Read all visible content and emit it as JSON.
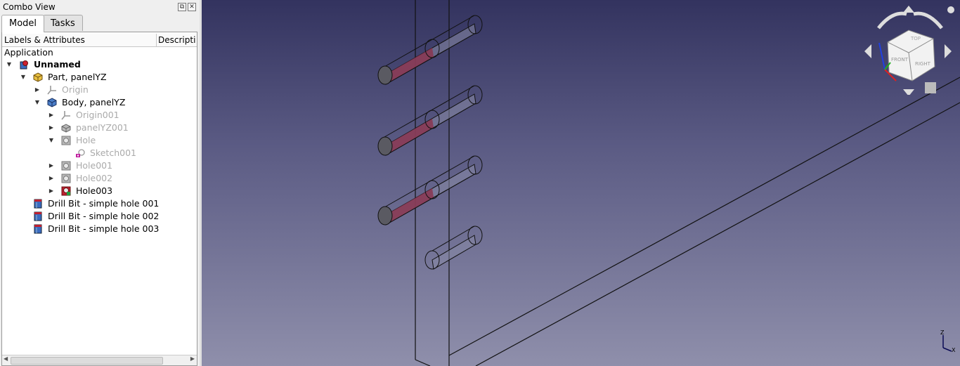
{
  "panel": {
    "title": "Combo View",
    "tabs": [
      {
        "label": "Model"
      },
      {
        "label": "Tasks"
      }
    ],
    "columns": [
      "Labels & Attributes",
      "Descripti"
    ]
  },
  "tree": {
    "root_label": "Application",
    "items": [
      {
        "label": "Unnamed",
        "icon": "document-icon"
      },
      {
        "label": "Part, panelYZ",
        "icon": "part-icon"
      },
      {
        "label": "Origin",
        "icon": "origin-icon"
      },
      {
        "label": "Body, panelYZ",
        "icon": "body-icon"
      },
      {
        "label": "Origin001",
        "icon": "origin-icon"
      },
      {
        "label": "panelYZ001",
        "icon": "pad-icon"
      },
      {
        "label": "Hole",
        "icon": "hole-icon"
      },
      {
        "label": "Sketch001",
        "icon": "sketch-icon"
      },
      {
        "label": "Hole001",
        "icon": "hole-icon"
      },
      {
        "label": "Hole002",
        "icon": "hole-icon"
      },
      {
        "label": "Hole003",
        "icon": "hole-tip-icon"
      },
      {
        "label": "Drill Bit - simple hole 001",
        "icon": "drill-bit-icon"
      },
      {
        "label": "Drill Bit - simple hole 002",
        "icon": "drill-bit-icon"
      },
      {
        "label": "Drill Bit - simple hole 003",
        "icon": "drill-bit-icon"
      }
    ]
  },
  "nav_cube": {
    "faces": [
      "TOP",
      "FRONT",
      "RIGHT"
    ],
    "axis_labels": [
      "Z",
      "X"
    ]
  },
  "colors": {
    "view_top": "#33335f",
    "view_bottom": "#8f8fab",
    "drill_bit": "#8a3550",
    "axis_x": "#e02020",
    "axis_y": "#20b020",
    "axis_z": "#2040e0"
  }
}
